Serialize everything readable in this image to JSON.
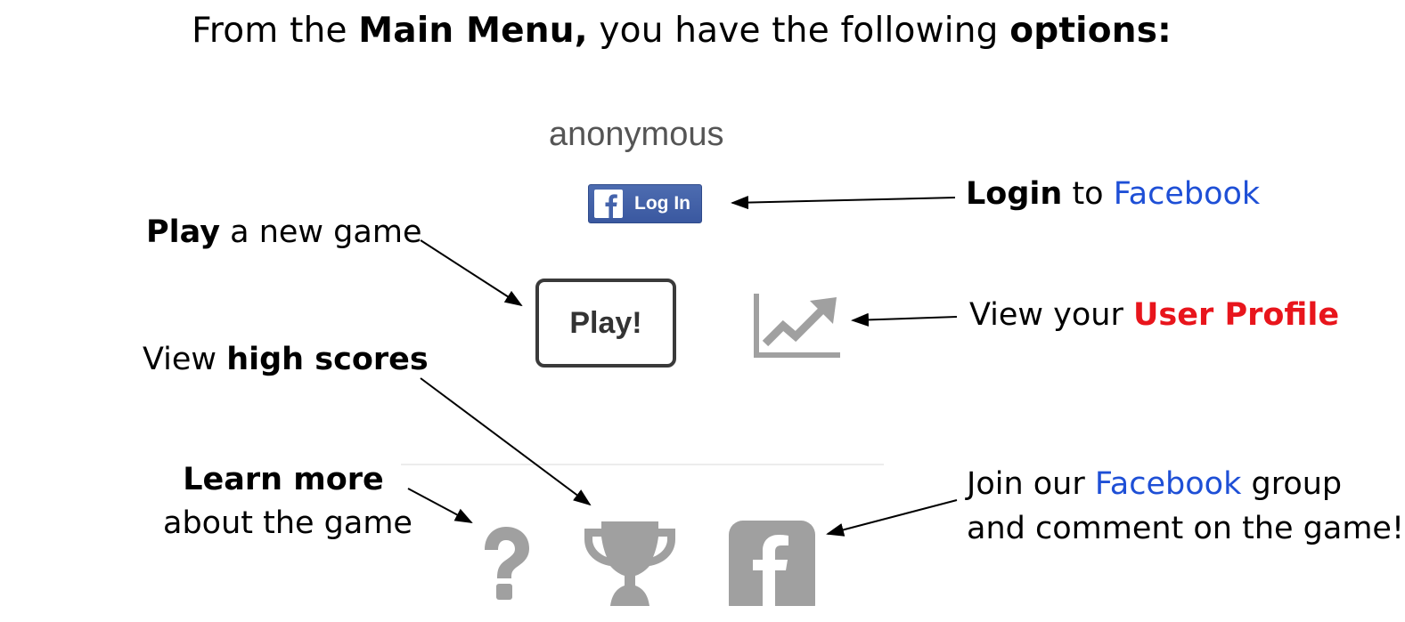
{
  "title": {
    "p1": "From the ",
    "b1": "Main Menu,",
    "p2": " you have the following ",
    "b2": "options:"
  },
  "menu": {
    "username": "anonymous",
    "fb_login_label": "Log In",
    "play_label": "Play!"
  },
  "annotations": {
    "login": {
      "bold": "Login",
      "mid": " to ",
      "link": "Facebook"
    },
    "play": {
      "bold": "Play",
      "rest": " a new game"
    },
    "profile": {
      "pre": "View your ",
      "highlight": "User Profile"
    },
    "highscores": {
      "pre": "View ",
      "bold": "high scores"
    },
    "learn": {
      "bold": "Learn more",
      "line2": "about the game"
    },
    "group": {
      "pre": "Join our ",
      "link": "Facebook",
      "post": " group",
      "line2": "and comment on the game!"
    }
  },
  "icons": [
    "facebook-icon",
    "profile-chart-icon",
    "help-icon",
    "trophy-icon",
    "facebook-group-icon"
  ],
  "colors": {
    "link_blue": "#1e4fd6",
    "profile_red": "#e8151c",
    "icon_gray": "#a0a0a0",
    "fb_blue": "#4463ab"
  }
}
